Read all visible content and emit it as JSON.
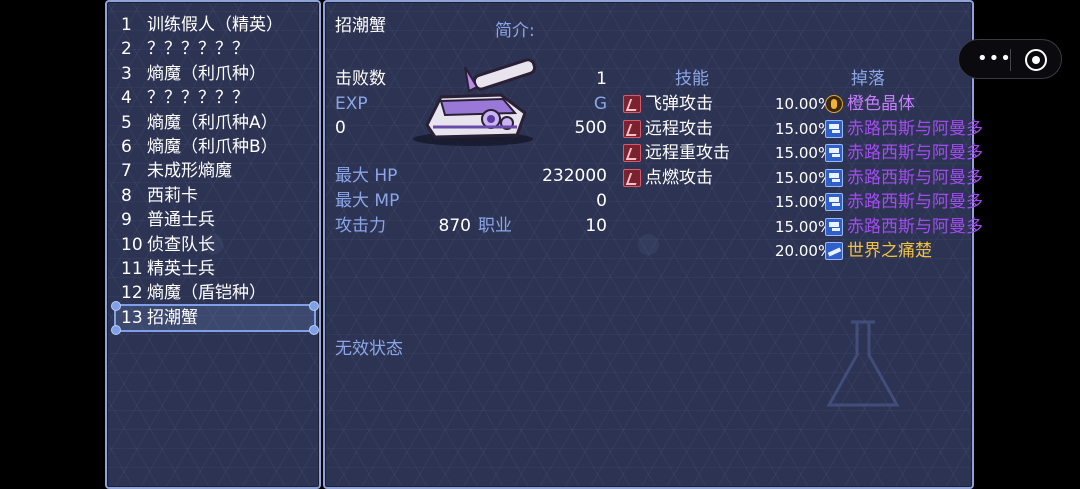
{
  "list": {
    "items": [
      {
        "num": "1",
        "name": "训练假人（精英）"
      },
      {
        "num": "2",
        "name": "？？？？？？"
      },
      {
        "num": "3",
        "name": "熵魔（利爪种）"
      },
      {
        "num": "4",
        "name": "？？？？？？"
      },
      {
        "num": "5",
        "name": "熵魔（利爪种A）"
      },
      {
        "num": "6",
        "name": "熵魔（利爪种B）"
      },
      {
        "num": "7",
        "name": "未成形熵魔"
      },
      {
        "num": "8",
        "name": "西莉卡"
      },
      {
        "num": "9",
        "name": "普通士兵"
      },
      {
        "num": "10",
        "name": "侦查队长"
      },
      {
        "num": "11",
        "name": "精英士兵"
      },
      {
        "num": "12",
        "name": "熵魔（盾铠种）"
      },
      {
        "num": "13",
        "name": "招潮蟹"
      }
    ],
    "selected_index": 13
  },
  "detail": {
    "name": "招潮蟹",
    "intro_label": "简介:",
    "defeat_label": "击败数",
    "defeat_value": "1",
    "exp_label": "EXP",
    "g_label": "G",
    "exp_value": "0",
    "g_value": "500",
    "hp_label": "最大 HP",
    "hp_value": "232000",
    "mp_label": "最大 MP",
    "mp_value": "0",
    "atk_label": "攻击力",
    "atk_value": "870",
    "job_label": "职业",
    "job_value": "10",
    "invalid_status_label": "无效状态",
    "skills_header": "技能",
    "skills": [
      "飞弹攻击",
      "远程攻击",
      "远程重攻击",
      "点燃攻击"
    ],
    "drops_header": "掉落",
    "drops": [
      {
        "pct": "10.00%",
        "name": "橙色晶体",
        "icon": "crystal-icon",
        "color": "#c77dff"
      },
      {
        "pct": "15.00%",
        "name": "赤路西斯与阿曼多",
        "icon": "gun-icon",
        "color": "#a24cf0"
      },
      {
        "pct": "15.00%",
        "name": "赤路西斯与阿曼多",
        "icon": "gun-icon",
        "color": "#a24cf0"
      },
      {
        "pct": "15.00%",
        "name": "赤路西斯与阿曼多",
        "icon": "gun-icon",
        "color": "#a24cf0"
      },
      {
        "pct": "15.00%",
        "name": "赤路西斯与阿曼多",
        "icon": "gun-icon",
        "color": "#a24cf0"
      },
      {
        "pct": "15.00%",
        "name": "赤路西斯与阿曼多",
        "icon": "gun-icon",
        "color": "#a24cf0"
      },
      {
        "pct": "20.00%",
        "name": "世界之痛楚",
        "icon": "world-icon",
        "color": "#f0c040"
      }
    ]
  },
  "colors": {
    "label_blue": "#8aa6e8",
    "window_bg": "#2d3352",
    "window_border": "#8ea3d8"
  }
}
